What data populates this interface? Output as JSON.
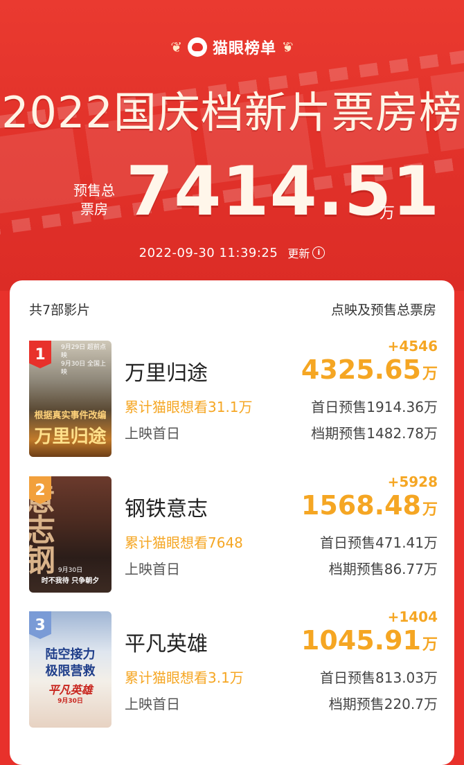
{
  "brand": {
    "name": "猫眼榜单",
    "laurel": "❦"
  },
  "title": "2022国庆档新片票房榜",
  "total": {
    "label_line1": "预售总",
    "label_line2": "票房",
    "value": "7414.51",
    "unit": "万"
  },
  "update": {
    "datetime": "2022-09-30  11:39:25",
    "label": "更新",
    "info_icon": "i"
  },
  "list": {
    "count_label": "共7部影片",
    "right_label": "点映及预售总票房"
  },
  "colors": {
    "accent": "#f5a623",
    "hero": "#e8312b",
    "rank1": "#e8312b",
    "rank2": "#f2a03c",
    "rank3": "#7a9bd6"
  },
  "movies": [
    {
      "rank": "1",
      "name": "万里归途",
      "want": "累计猫眼想看31.1万",
      "release": "上映首日",
      "delta": "+4546",
      "box": "4325.65",
      "unit": "万",
      "first_day": "首日预售1914.36万",
      "period": "档期预售1482.78万",
      "poster_title": "万里归途",
      "poster_tag": "根据真实事件改编",
      "poster_notes": [
        "9月29日 超前点映",
        "9月30日 全国上映"
      ]
    },
    {
      "rank": "2",
      "name": "钢铁意志",
      "want": "累计猫眼想看7648",
      "release": "上映首日",
      "delta": "+5928",
      "box": "1568.48",
      "unit": "万",
      "first_day": "首日预售471.41万",
      "period": "档期预售86.77万",
      "poster_title": "意志钢铁",
      "poster_date": "9月30日",
      "poster_tag": "时不我待 只争朝夕"
    },
    {
      "rank": "3",
      "name": "平凡英雄",
      "want": "累计猫眼想看3.1万",
      "release": "上映首日",
      "delta": "+1404",
      "box": "1045.91",
      "unit": "万",
      "first_day": "首日预售813.03万",
      "period": "档期预售220.7万",
      "poster_tag1": "陆空接力",
      "poster_tag2": "极限营救",
      "poster_title": "平凡英雄",
      "poster_date": "9月30日"
    }
  ]
}
